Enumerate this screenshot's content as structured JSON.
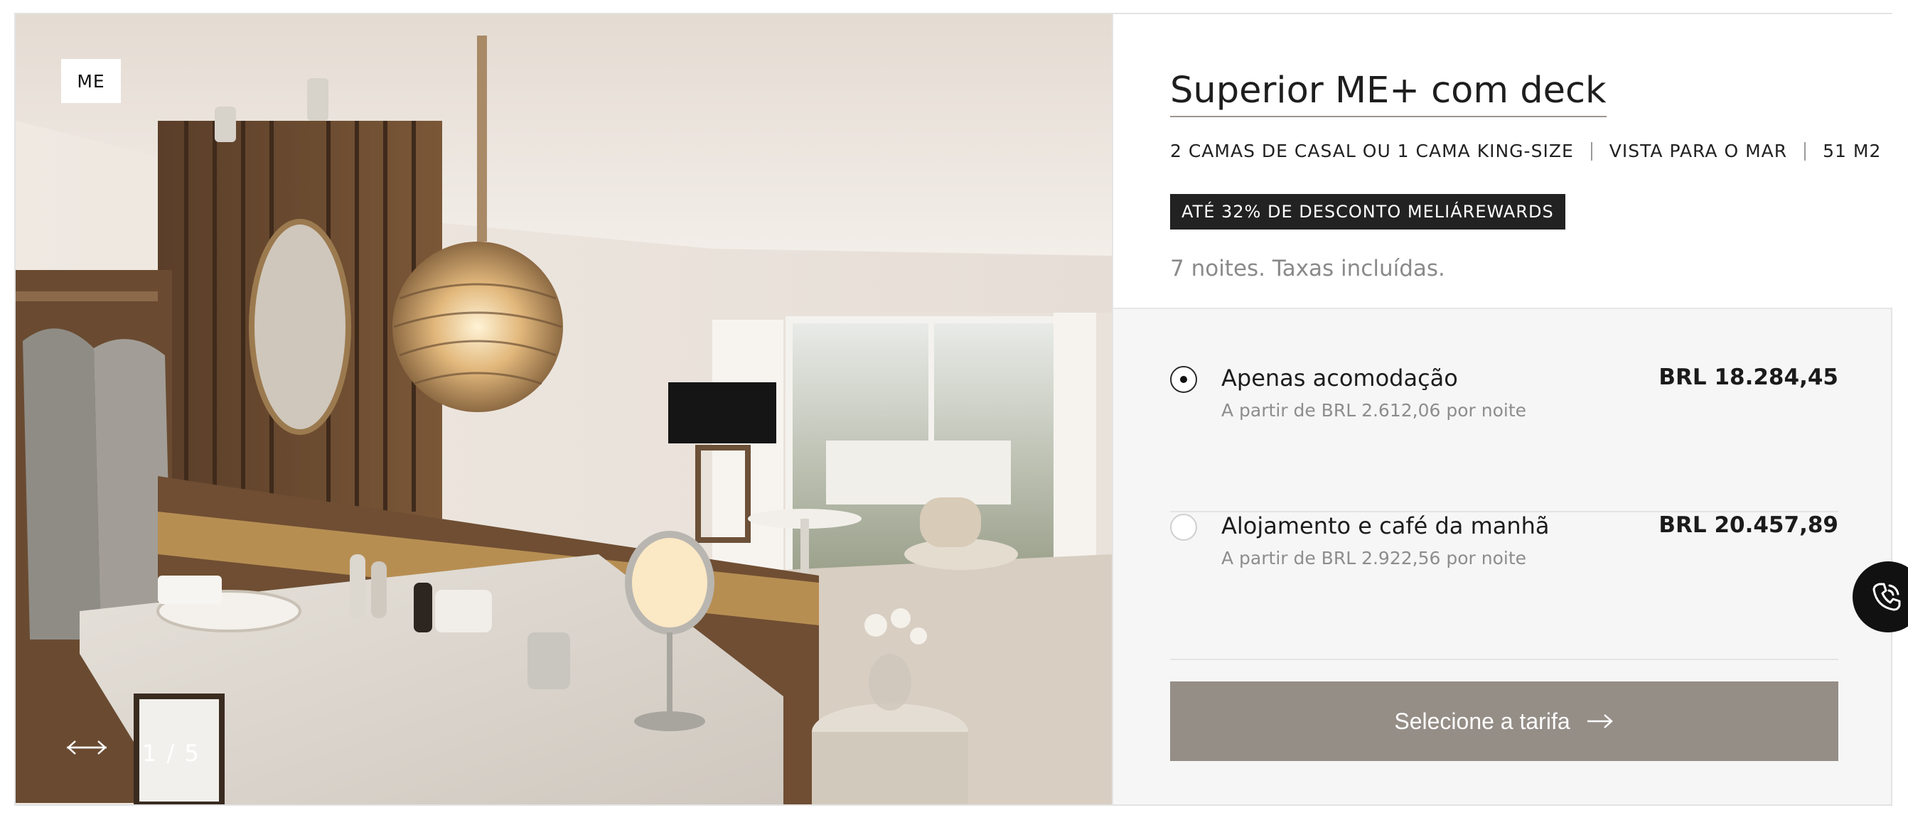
{
  "gallery": {
    "brand_badge": "ME",
    "counter": "1 / 5",
    "prev_icon": "arrow-left-icon",
    "next_icon": "arrow-right-icon"
  },
  "room": {
    "title": "Superior ME+ com deck",
    "features": [
      "2 CAMAS DE CASAL OU 1 CAMA KING-SIZE",
      "VISTA PARA O MAR",
      "51 M2"
    ],
    "discount_badge": "ATÉ 32% DE DESCONTO MELIÁREWARDS",
    "stay_info": "7 noites. Taxas incluídas."
  },
  "rates": [
    {
      "name": "Apenas acomodação",
      "subtitle": "A partir de BRL 2.612,06 por noite",
      "price": "BRL 18.284,45",
      "selected": true
    },
    {
      "name": "Alojamento e café da manhã",
      "subtitle": "A partir de BRL 2.922,56 por noite",
      "price": "BRL 20.457,89",
      "selected": false
    }
  ],
  "cta": {
    "label": "Selecione a tarifa",
    "icon": "arrow-right-icon"
  },
  "call_button": {
    "icon": "phone-icon"
  },
  "colors": {
    "cta_bg": "#958e87",
    "badge_bg": "#222222",
    "panel_bg": "#f6f6f6"
  }
}
